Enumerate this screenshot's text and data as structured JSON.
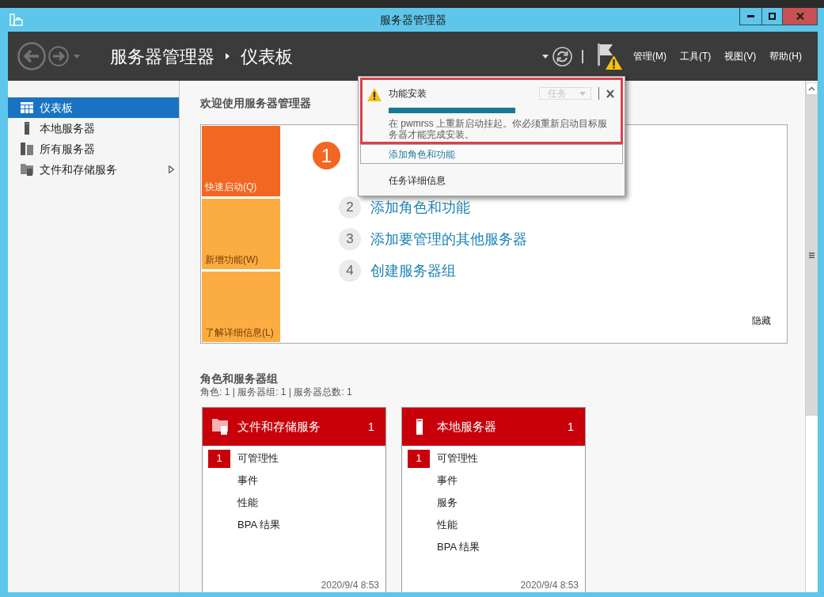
{
  "window": {
    "title": "服务器管理器"
  },
  "header": {
    "breadcrumb": [
      "服务器管理器",
      "仪表板"
    ],
    "notifications": {
      "warning": true
    },
    "menu": [
      {
        "label": "管理(M)"
      },
      {
        "label": "工具(T)"
      },
      {
        "label": "视图(V)"
      },
      {
        "label": "帮助(H)"
      }
    ]
  },
  "sidebar": {
    "items": [
      {
        "label": "仪表板",
        "selected": true,
        "has_submenu": false
      },
      {
        "label": "本地服务器",
        "selected": false,
        "has_submenu": false
      },
      {
        "label": "所有服务器",
        "selected": false,
        "has_submenu": false
      },
      {
        "label": "文件和存储服务",
        "selected": false,
        "has_submenu": true
      }
    ]
  },
  "welcome": {
    "title": "欢迎使用服务器管理器",
    "tiles": [
      {
        "label": "快速启动(Q)",
        "selected": true
      },
      {
        "label": "新增功能(W)",
        "selected": false
      },
      {
        "label": "了解详细信息(L)",
        "selected": false
      }
    ],
    "steps": [
      {
        "number": "1",
        "selected": true
      },
      {
        "number": "2",
        "label": "添加角色和功能",
        "selected": false
      },
      {
        "number": "3",
        "label": "添加要管理的其他服务器",
        "selected": false
      },
      {
        "number": "4",
        "label": "创建服务器组",
        "selected": false
      }
    ],
    "hide_link": "隐藏"
  },
  "roles": {
    "title": "角色和服务器组",
    "summary": "角色: 1 | 服务器组: 1 | 服务器总数: 1",
    "cards": [
      {
        "title": "文件和存储服务",
        "count": "1",
        "alert": true,
        "items": [
          {
            "label": "可管理性",
            "badge": "1"
          },
          {
            "label": "事件"
          },
          {
            "label": "性能"
          },
          {
            "label": "BPA 结果"
          }
        ],
        "timestamp": "2020/9/4 8:53"
      },
      {
        "title": "本地服务器",
        "count": "1",
        "alert": true,
        "items": [
          {
            "label": "可管理性",
            "badge": "1"
          },
          {
            "label": "事件"
          },
          {
            "label": "服务"
          },
          {
            "label": "性能"
          },
          {
            "label": "BPA 结果"
          }
        ],
        "timestamp": "2020/9/4 8:53"
      }
    ]
  },
  "notification_popup": {
    "highlighted": true,
    "title": "功能安装",
    "task_menu": {
      "label": "任务",
      "disabled": true
    },
    "progress": {
      "level": 1
    },
    "message": "在 pwmrss 上重新启动挂起。你必须重新启动目标服务器才能完成安装。",
    "links": [
      {
        "label": "添加角色和功能",
        "kind": "action",
        "selected": true
      },
      {
        "label": "任务详细信息",
        "kind": "command",
        "selected": false
      }
    ]
  }
}
